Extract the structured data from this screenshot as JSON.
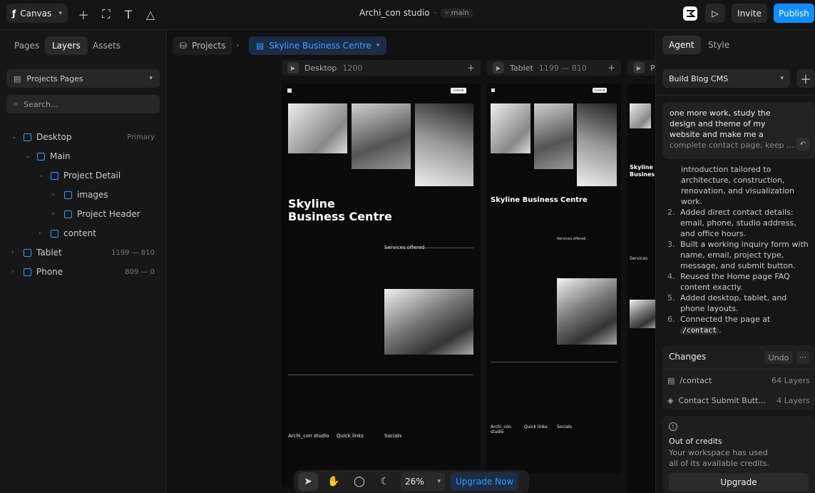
{
  "topbar": {
    "app_name": "Canvas",
    "project": "Archi_con studio",
    "branch": "main",
    "invite": "Invite",
    "publish": "Publish"
  },
  "left": {
    "tabs": [
      "Pages",
      "Layers",
      "Assets"
    ],
    "pages_select": "Projects Pages",
    "search_placeholder": "Search...",
    "layers": [
      {
        "label": "Desktop",
        "meta": "Primary"
      },
      {
        "label": "Main",
        "meta": ""
      },
      {
        "label": "Project Detail",
        "meta": ""
      },
      {
        "label": "images",
        "meta": ""
      },
      {
        "label": "Project Header",
        "meta": ""
      },
      {
        "label": "content",
        "meta": ""
      },
      {
        "label": "Tablet",
        "meta": "1199 — 810"
      },
      {
        "label": "Phone",
        "meta": "809 — 0"
      }
    ]
  },
  "canvas": {
    "crumb_projects": "Projects",
    "crumb_current": "Skyline Business Centre",
    "frames": [
      {
        "name": "Desktop",
        "size": "1200"
      },
      {
        "name": "Tablet",
        "size": "1199 — 810"
      },
      {
        "name": "P",
        "size": ""
      }
    ],
    "site": {
      "title_line1": "Skyline",
      "title_line2": "Business Centre",
      "tablet_title": "Skyline Business Centre",
      "phone_title_1": "Skyline",
      "phone_title_2": "Busines",
      "services_heading": "Services offered",
      "phone_services": "Services",
      "brand": "Archi_con studio",
      "quick_links": "Quick links",
      "socials": "Socials",
      "cta": "Consult"
    },
    "zoom": "26%",
    "upgrade_now": "Upgrade Now"
  },
  "right": {
    "tabs": [
      "Agent",
      "Style"
    ],
    "select": "Build Blog CMS",
    "message_lines": [
      "one more work, study the",
      "design and theme of my",
      "website and  make me a",
      "complete contact page, keep ..."
    ],
    "intro_lines": [
      "introduction tailored to",
      "architecture, construction,",
      "renovation, and visualization",
      "work."
    ],
    "items": [
      {
        "n": "2.",
        "text": "Added direct contact details: email, phone, studio address, and office hours."
      },
      {
        "n": "3.",
        "text": "Built a working inquiry form with name, email, project type, message, and submit button."
      },
      {
        "n": "4.",
        "text": "Reused the Home page FAQ content exactly."
      },
      {
        "n": "5.",
        "text": "Added desktop, tablet, and phone layouts."
      },
      {
        "n": "6.",
        "text": "Connected the page at"
      }
    ],
    "code_path": "/contact",
    "changes_title": "Changes",
    "undo": "Undo",
    "changes": [
      {
        "name": "/contact",
        "count": "64 Layers"
      },
      {
        "name": "Contact Submit Butt...",
        "count": "4 Layers"
      }
    ],
    "credits_title": "Out of credits",
    "credits_text_1": "Your workspace has used",
    "credits_text_2": "all of its available credits.",
    "upgrade": "Upgrade"
  }
}
